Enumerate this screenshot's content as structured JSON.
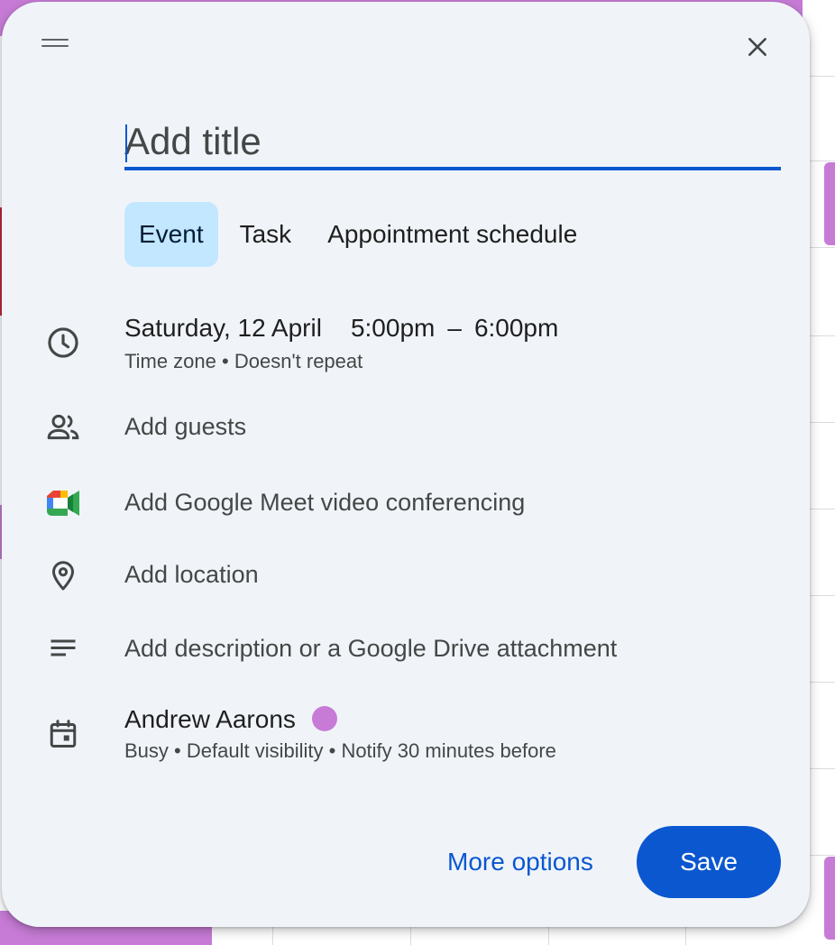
{
  "event_dialog": {
    "title_placeholder": "Add title",
    "tabs": [
      {
        "label": "Event",
        "active": true
      },
      {
        "label": "Task",
        "active": false
      },
      {
        "label": "Appointment schedule",
        "active": false
      }
    ],
    "datetime": {
      "date": "Saturday, 12 April",
      "start_time": "5:00pm",
      "separator": "–",
      "end_time": "6:00pm",
      "timezone_label": "Time zone",
      "bullet": "•",
      "repeat_label": "Doesn't repeat"
    },
    "add_guests_label": "Add guests",
    "meet_label": "Add Google Meet video conferencing",
    "location_label": "Add location",
    "description_label": "Add description or a Google Drive attachment",
    "calendar": {
      "owner": "Andrew Aarons",
      "color": "#c77bd6",
      "availability": "Busy",
      "bullet1": "•",
      "visibility": "Default visibility",
      "bullet2": "•",
      "notification": "Notify 30 minutes before"
    },
    "more_options_label": "More options",
    "save_label": "Save"
  },
  "colors": {
    "dialog_bg": "#f0f4f9",
    "accent": "#0b57d0",
    "active_tab_bg": "#c2e7ff",
    "calendar_event_purple": "#c77bd6"
  },
  "icons": {
    "drag": "drag-handle-icon",
    "close": "close-icon",
    "time": "clock-icon",
    "guests": "people-icon",
    "meet": "google-meet-icon",
    "location": "location-pin-icon",
    "description": "notes-icon",
    "calendar": "calendar-icon"
  }
}
